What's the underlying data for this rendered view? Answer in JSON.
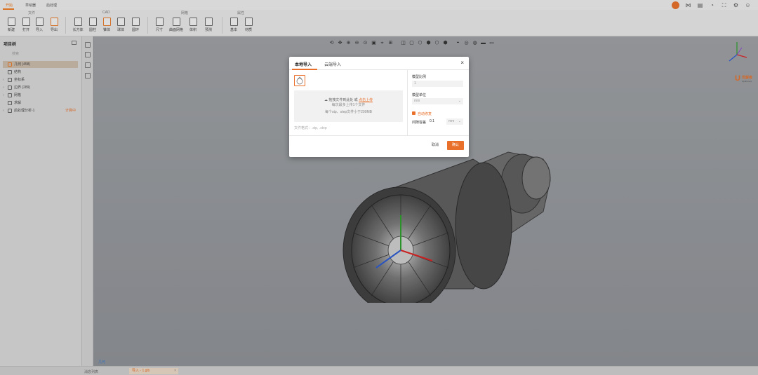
{
  "tabs": [
    {
      "label": "开始",
      "active": true
    },
    {
      "label": "草绘器",
      "active": false
    },
    {
      "label": "后处理",
      "active": false
    }
  ],
  "ribbon": {
    "groups": [
      {
        "label": "文件"
      },
      {
        "label": "CAD"
      },
      {
        "label": "网格"
      },
      {
        "label": "属性"
      }
    ],
    "tools": [
      {
        "label": "新建",
        "icon": "new-file-icon"
      },
      {
        "label": "打开",
        "icon": "open-folder-icon"
      },
      {
        "label": "导入",
        "icon": "import-icon"
      },
      {
        "label": "导出",
        "icon": "export-icon"
      },
      {
        "label": "长方体",
        "icon": "cuboid-icon"
      },
      {
        "label": "圆柱",
        "icon": "cylinder-icon"
      },
      {
        "label": "锥体",
        "icon": "cone-icon"
      },
      {
        "label": "球体",
        "icon": "sphere-icon"
      },
      {
        "label": "圆环",
        "icon": "torus-icon"
      },
      {
        "label": "尺寸",
        "icon": "size-icon"
      },
      {
        "label": "曲面网格",
        "icon": "surface-mesh-icon"
      },
      {
        "label": "体积",
        "icon": "volume-icon"
      },
      {
        "label": "预测",
        "icon": "predict-icon"
      },
      {
        "label": "基本",
        "icon": "basic-icon"
      },
      {
        "label": "材质",
        "icon": "material-icon"
      }
    ]
  },
  "left_panel": {
    "title": "项目树",
    "search_placeholder": "搜索",
    "tree": [
      {
        "label": "几何 (458)",
        "selected": true,
        "expandable": false
      },
      {
        "label": "结构",
        "selected": false,
        "expandable": false
      },
      {
        "label": "坐标系",
        "selected": false,
        "expandable": true
      },
      {
        "label": "边界 (289)",
        "selected": false,
        "expandable": true
      },
      {
        "label": "网格",
        "selected": false,
        "expandable": true
      },
      {
        "label": "求解",
        "selected": false,
        "expandable": false
      },
      {
        "label": "后处理分析-1",
        "selected": false,
        "expandable": true,
        "badge": "计算中"
      }
    ]
  },
  "viewport": {
    "label": "几何",
    "brand_name": "优解者",
    "brand_sub": "OptiFuture"
  },
  "status_bar": {
    "output_label": "消息列表",
    "active_tab": "导入 - 1.glb"
  },
  "dialog": {
    "tab_local": "本地导入",
    "tab_cloud": "云端导入",
    "drop_text": "拖拽文件到此处 或",
    "drop_link": "点击上传",
    "drop_limit": "每次最多上传1个文件",
    "drop_size": "每个stp、step文件小于200MB",
    "supported_formats": "文件格式：.stp, .step",
    "scale_label": "模型比例",
    "scale_value": "1",
    "unit_label": "模型单位",
    "unit_value": "mm",
    "auto_repair_label": "自动修复",
    "auto_repair_checked": true,
    "tolerance_label": "间隙容差",
    "tolerance_value": "0.1",
    "tolerance_unit": "mm",
    "cancel_label": "取消",
    "ok_label": "确认"
  },
  "colors": {
    "accent": "#e8702a",
    "viewport_bg": "#9a9da1"
  }
}
